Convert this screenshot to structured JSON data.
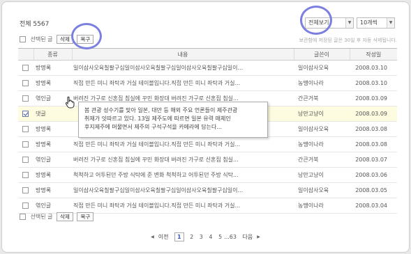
{
  "total_label": "전체 5567",
  "view_select": {
    "value": "전체보기"
  },
  "count_select": {
    "value": "10개씩"
  },
  "actions": {
    "selected_label": "선택된 글",
    "delete": "삭제",
    "restore": "복구"
  },
  "notice": "보관함에 저장된 글은 30일 후 자동 삭제됩니다.",
  "table": {
    "headers": [
      "종류",
      "내용",
      "글쓴이",
      "작성일"
    ],
    "rows": [
      {
        "type": "방명록",
        "content": "일이삼사오육칠팔구십일이삼사오육칠팔구십일이삼사오육칠팔구십일이...",
        "author": "일이삼사오육",
        "date": "2008.03.10",
        "checked": false
      },
      {
        "type": "방명록",
        "content": "직접 만든 미니 좌탁과 거실 테이블입니다.직접 만든 미니 좌탁과 거실...",
        "author": "농땡이나라",
        "date": "2008.03.10",
        "checked": false
      },
      {
        "type": "엮인글",
        "content": "버려진 가구로 신혼집 침실에 꾸민 화장대 버려진 가구로 신혼집 침실...",
        "author": "간큰거북",
        "date": "2008.03.09",
        "checked": false
      },
      {
        "type": "댓글",
        "content": "",
        "author": "낭만고냥이",
        "date": "2008.03.09",
        "checked": true
      },
      {
        "type": "방명록",
        "content": "",
        "author": "일이삼사오육",
        "date": "2008.03.08",
        "checked": false
      },
      {
        "type": "방명록",
        "content": "직접 만든 미니 좌탁과 거실 테이블입니다.직접 만든 미니 좌탁과 거실...",
        "author": "농땡이나라",
        "date": "2008.03.08",
        "checked": false
      },
      {
        "type": "엮인글",
        "content": "버려진 가구로 신혼집 침실에 꾸민 화장대 버려진 가구로 신혼집 침실...",
        "author": "간큰거북",
        "date": "2008.03.07",
        "checked": false
      },
      {
        "type": "방명록",
        "content": "척척하고 어투된던 주방 식탁에 준 변화 척척하고 어투된던 주방 식탁...",
        "author": "낭만고냥이",
        "date": "2008.03.06",
        "checked": false
      },
      {
        "type": "방명록",
        "content": "일이삼사오육칠팔구십일이삼사오육칠팔구십일이삼사오육칠팔구십일이...",
        "author": "일이삼사오육",
        "date": "2008.03.05",
        "checked": false
      },
      {
        "type": "엮인글",
        "content": "직접 만든 미니 좌탁과 거실 테이블입니다.직접 만든 미니 좌탁과 거실...",
        "author": "농땡이나라",
        "date": "2008.03.04",
        "checked": false
      }
    ]
  },
  "tooltip": {
    "line1": "봄 관광 성수기를 맞아 일본, 대만 등 해외 주요 언론들이 제주관광",
    "line2": "취재가 잇따르고 있다. 13일 제주도에 따르면 일본 유력 매체인",
    "line3": "후지제주에 머물면서 제주의 구석구석을 카메라에 담는다..."
  },
  "pagination": {
    "prev": "이전",
    "pages": [
      "1",
      "2",
      "3",
      "4",
      "5"
    ],
    "ellipsis": "...",
    "last": "63",
    "next": "다음",
    "current": "1"
  },
  "colors": {
    "highlight_circle": "#7b7fe0",
    "selected_row": "#fdfbe0",
    "current_page": "#3657c0"
  }
}
